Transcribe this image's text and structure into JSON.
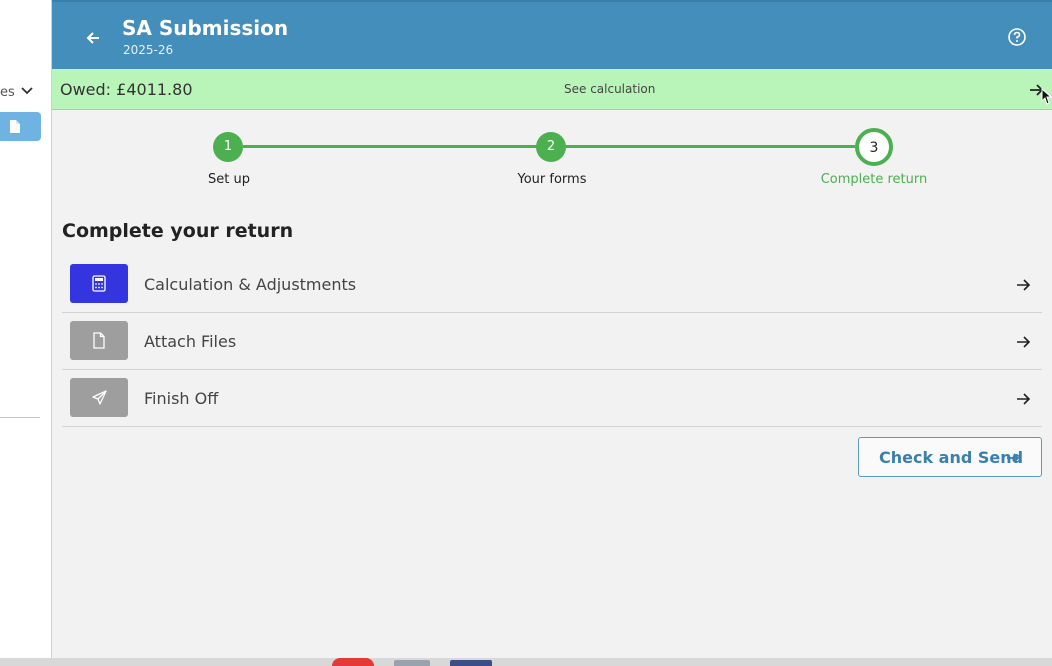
{
  "left_pane": {
    "dropdown_text": "es"
  },
  "header": {
    "title": "SA Submission",
    "subtitle": "2025-26"
  },
  "owed_bar": {
    "owed_text": "Owed: £4011.80",
    "link": "See calculation"
  },
  "stepper": {
    "steps": [
      {
        "number": "1",
        "label": "Set up"
      },
      {
        "number": "2",
        "label": "Your forms"
      },
      {
        "number": "3",
        "label": "Complete return"
      }
    ],
    "current_step": 3
  },
  "main": {
    "section_title": "Complete your return",
    "tasks": [
      {
        "label": "Calculation & Adjustments",
        "icon": "calculator-icon"
      },
      {
        "label": "Attach Files",
        "icon": "file-icon"
      },
      {
        "label": "Finish Off",
        "icon": "send-icon"
      }
    ],
    "check_send_label": "Check and Send"
  },
  "colors": {
    "header": "#438ebb",
    "owed_bar": "#b9f5b9",
    "step_green": "#4caf50",
    "active_task_icon": "#3535e0",
    "inactive_task_icon": "#9e9e9e"
  }
}
